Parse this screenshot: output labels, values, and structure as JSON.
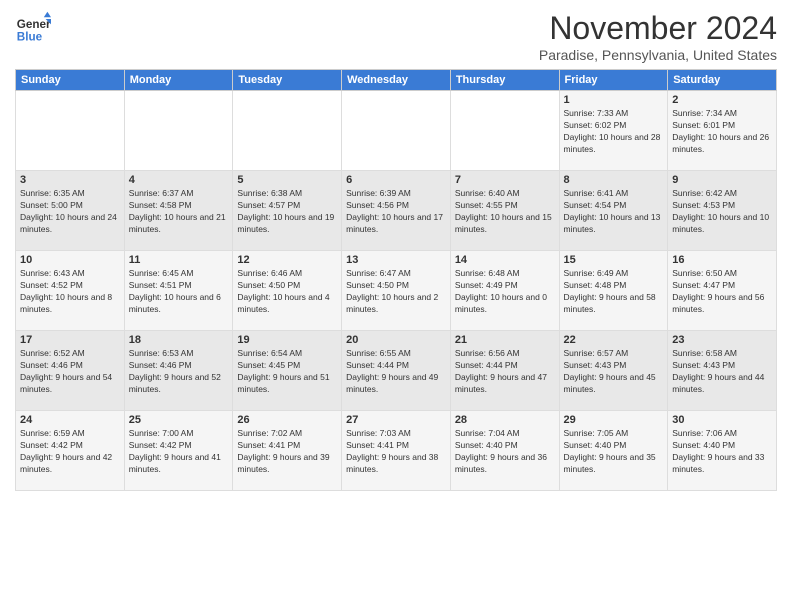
{
  "logo": {
    "general": "General",
    "blue": "Blue"
  },
  "header": {
    "month": "November 2024",
    "location": "Paradise, Pennsylvania, United States"
  },
  "weekdays": [
    "Sunday",
    "Monday",
    "Tuesday",
    "Wednesday",
    "Thursday",
    "Friday",
    "Saturday"
  ],
  "weeks": [
    [
      {
        "day": "",
        "info": ""
      },
      {
        "day": "",
        "info": ""
      },
      {
        "day": "",
        "info": ""
      },
      {
        "day": "",
        "info": ""
      },
      {
        "day": "",
        "info": ""
      },
      {
        "day": "1",
        "info": "Sunrise: 7:33 AM\nSunset: 6:02 PM\nDaylight: 10 hours and 28 minutes."
      },
      {
        "day": "2",
        "info": "Sunrise: 7:34 AM\nSunset: 6:01 PM\nDaylight: 10 hours and 26 minutes."
      }
    ],
    [
      {
        "day": "3",
        "info": "Sunrise: 6:35 AM\nSunset: 5:00 PM\nDaylight: 10 hours and 24 minutes."
      },
      {
        "day": "4",
        "info": "Sunrise: 6:37 AM\nSunset: 4:58 PM\nDaylight: 10 hours and 21 minutes."
      },
      {
        "day": "5",
        "info": "Sunrise: 6:38 AM\nSunset: 4:57 PM\nDaylight: 10 hours and 19 minutes."
      },
      {
        "day": "6",
        "info": "Sunrise: 6:39 AM\nSunset: 4:56 PM\nDaylight: 10 hours and 17 minutes."
      },
      {
        "day": "7",
        "info": "Sunrise: 6:40 AM\nSunset: 4:55 PM\nDaylight: 10 hours and 15 minutes."
      },
      {
        "day": "8",
        "info": "Sunrise: 6:41 AM\nSunset: 4:54 PM\nDaylight: 10 hours and 13 minutes."
      },
      {
        "day": "9",
        "info": "Sunrise: 6:42 AM\nSunset: 4:53 PM\nDaylight: 10 hours and 10 minutes."
      }
    ],
    [
      {
        "day": "10",
        "info": "Sunrise: 6:43 AM\nSunset: 4:52 PM\nDaylight: 10 hours and 8 minutes."
      },
      {
        "day": "11",
        "info": "Sunrise: 6:45 AM\nSunset: 4:51 PM\nDaylight: 10 hours and 6 minutes."
      },
      {
        "day": "12",
        "info": "Sunrise: 6:46 AM\nSunset: 4:50 PM\nDaylight: 10 hours and 4 minutes."
      },
      {
        "day": "13",
        "info": "Sunrise: 6:47 AM\nSunset: 4:50 PM\nDaylight: 10 hours and 2 minutes."
      },
      {
        "day": "14",
        "info": "Sunrise: 6:48 AM\nSunset: 4:49 PM\nDaylight: 10 hours and 0 minutes."
      },
      {
        "day": "15",
        "info": "Sunrise: 6:49 AM\nSunset: 4:48 PM\nDaylight: 9 hours and 58 minutes."
      },
      {
        "day": "16",
        "info": "Sunrise: 6:50 AM\nSunset: 4:47 PM\nDaylight: 9 hours and 56 minutes."
      }
    ],
    [
      {
        "day": "17",
        "info": "Sunrise: 6:52 AM\nSunset: 4:46 PM\nDaylight: 9 hours and 54 minutes."
      },
      {
        "day": "18",
        "info": "Sunrise: 6:53 AM\nSunset: 4:46 PM\nDaylight: 9 hours and 52 minutes."
      },
      {
        "day": "19",
        "info": "Sunrise: 6:54 AM\nSunset: 4:45 PM\nDaylight: 9 hours and 51 minutes."
      },
      {
        "day": "20",
        "info": "Sunrise: 6:55 AM\nSunset: 4:44 PM\nDaylight: 9 hours and 49 minutes."
      },
      {
        "day": "21",
        "info": "Sunrise: 6:56 AM\nSunset: 4:44 PM\nDaylight: 9 hours and 47 minutes."
      },
      {
        "day": "22",
        "info": "Sunrise: 6:57 AM\nSunset: 4:43 PM\nDaylight: 9 hours and 45 minutes."
      },
      {
        "day": "23",
        "info": "Sunrise: 6:58 AM\nSunset: 4:43 PM\nDaylight: 9 hours and 44 minutes."
      }
    ],
    [
      {
        "day": "24",
        "info": "Sunrise: 6:59 AM\nSunset: 4:42 PM\nDaylight: 9 hours and 42 minutes."
      },
      {
        "day": "25",
        "info": "Sunrise: 7:00 AM\nSunset: 4:42 PM\nDaylight: 9 hours and 41 minutes."
      },
      {
        "day": "26",
        "info": "Sunrise: 7:02 AM\nSunset: 4:41 PM\nDaylight: 9 hours and 39 minutes."
      },
      {
        "day": "27",
        "info": "Sunrise: 7:03 AM\nSunset: 4:41 PM\nDaylight: 9 hours and 38 minutes."
      },
      {
        "day": "28",
        "info": "Sunrise: 7:04 AM\nSunset: 4:40 PM\nDaylight: 9 hours and 36 minutes."
      },
      {
        "day": "29",
        "info": "Sunrise: 7:05 AM\nSunset: 4:40 PM\nDaylight: 9 hours and 35 minutes."
      },
      {
        "day": "30",
        "info": "Sunrise: 7:06 AM\nSunset: 4:40 PM\nDaylight: 9 hours and 33 minutes."
      }
    ]
  ]
}
